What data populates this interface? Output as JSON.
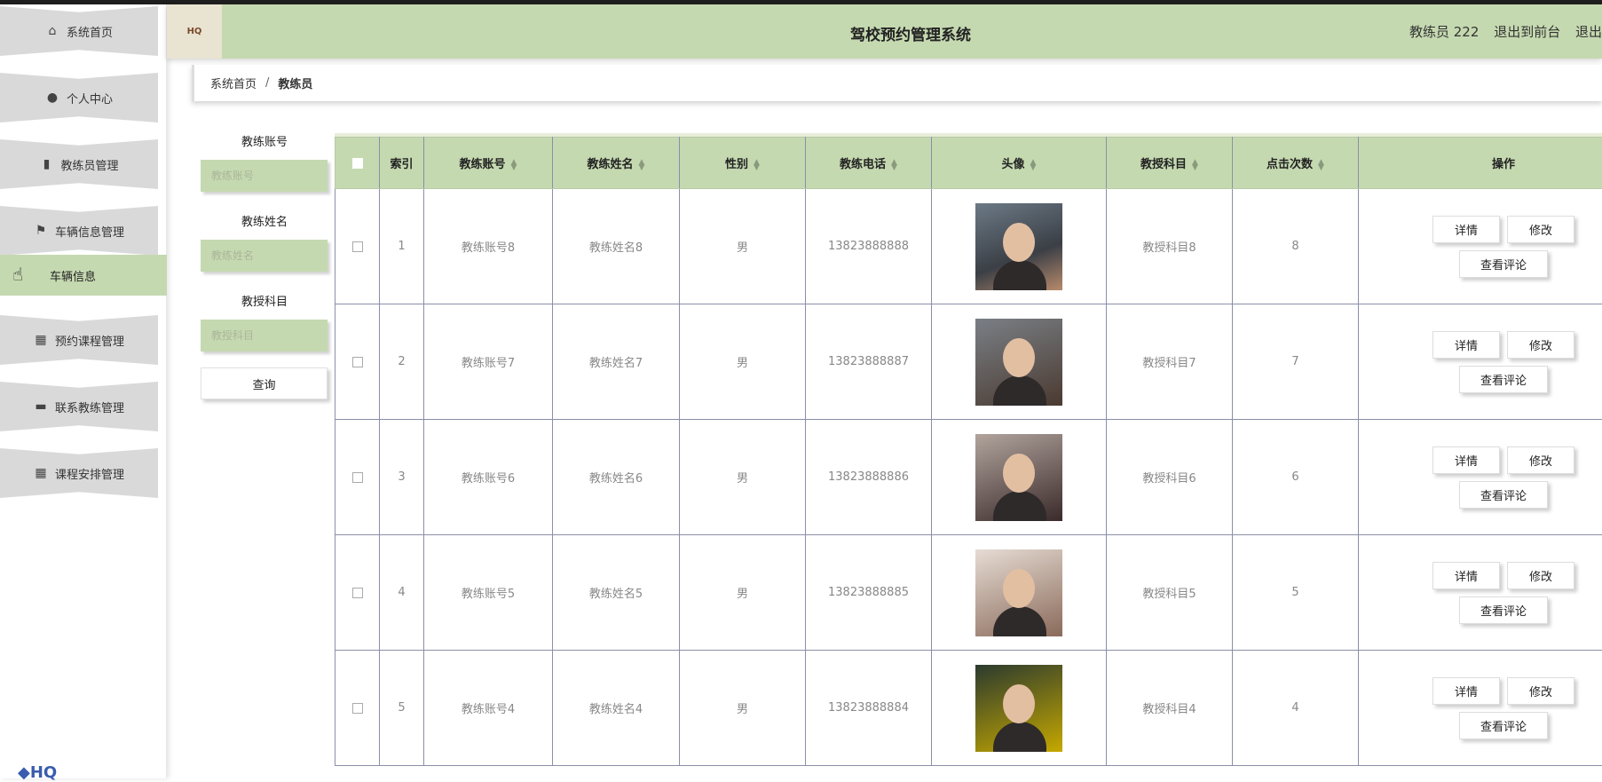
{
  "header": {
    "title": "驾校预约管理系统",
    "user": "教练员 222",
    "to_front": "退出到前台",
    "logout": "退出登录"
  },
  "sidebar": {
    "items": [
      {
        "label": "系统首页",
        "icon": "home-icon"
      },
      {
        "label": "个人中心",
        "icon": "user-icon"
      },
      {
        "label": "教练员管理",
        "icon": "clipboard-icon"
      },
      {
        "label": "车辆信息管理",
        "icon": "flag-icon"
      },
      {
        "label": "预约课程管理",
        "icon": "grid-icon"
      },
      {
        "label": "联系教练管理",
        "icon": "monitor-icon"
      },
      {
        "label": "课程安排管理",
        "icon": "grid-icon"
      }
    ],
    "sub_item": "车辆信息"
  },
  "breadcrumb": {
    "home": "系统首页",
    "separator": "/",
    "current": "教练员"
  },
  "search": {
    "fields": [
      {
        "label": "教练账号",
        "placeholder": "教练账号"
      },
      {
        "label": "教练姓名",
        "placeholder": "教练姓名"
      },
      {
        "label": "教授科目",
        "placeholder": "教授科目"
      }
    ],
    "button": "查询"
  },
  "table": {
    "columns": [
      "索引",
      "教练账号",
      "教练姓名",
      "性别",
      "教练电话",
      "头像",
      "教授科目",
      "点击次数",
      "操作"
    ],
    "rows": [
      {
        "index": "1",
        "account": "教练账号8",
        "name": "教练姓名8",
        "gender": "男",
        "phone": "13823888888",
        "subject": "教授科目8",
        "clicks": "8"
      },
      {
        "index": "2",
        "account": "教练账号7",
        "name": "教练姓名7",
        "gender": "男",
        "phone": "13823888887",
        "subject": "教授科目7",
        "clicks": "7"
      },
      {
        "index": "3",
        "account": "教练账号6",
        "name": "教练姓名6",
        "gender": "男",
        "phone": "13823888886",
        "subject": "教授科目6",
        "clicks": "6"
      },
      {
        "index": "4",
        "account": "教练账号5",
        "name": "教练姓名5",
        "gender": "男",
        "phone": "13823888885",
        "subject": "教授科目5",
        "clicks": "5"
      },
      {
        "index": "5",
        "account": "教练账号4",
        "name": "教练姓名4",
        "gender": "男",
        "phone": "13823888884",
        "subject": "教授科目4",
        "clicks": "4"
      }
    ],
    "actions": {
      "detail": "详情",
      "edit": "修改",
      "comments": "查看评论"
    }
  },
  "colors": {
    "accent": "#c5d9b0",
    "sidebar_item": "#d9d9d9"
  }
}
